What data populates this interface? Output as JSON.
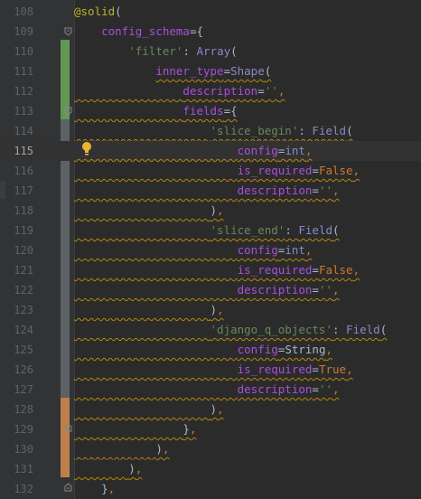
{
  "editor": {
    "current_line": "115",
    "colors": {
      "background": "#2b2b2b",
      "gutter": "#313335",
      "keyword_orange": "#cc7832",
      "string_green": "#6a8759",
      "builtin_blue": "#8888c6",
      "purple_kw": "#aa4fdb",
      "decorator_yellow": "#bbb529",
      "warning_wave": "#b8860b",
      "vcs_added": "#629755",
      "vcs_modified": "#5c6164",
      "vcs_changed": "#c07f4a"
    },
    "lines": [
      {
        "num": "108",
        "tokens": [
          {
            "t": "@solid",
            "c": "#bbb529"
          },
          {
            "t": "(",
            "c": "#a9b7c6"
          }
        ]
      },
      {
        "num": "109",
        "tokens": [
          {
            "t": "    "
          },
          {
            "t": "config_schema",
            "c": "#aa4fdb"
          },
          {
            "t": "={",
            "c": "#a9b7c6"
          }
        ]
      },
      {
        "num": "110",
        "tokens": [
          {
            "t": "        "
          },
          {
            "t": "'filter'",
            "c": "#6a8759"
          },
          {
            "t": ": ",
            "c": "#a9b7c6"
          },
          {
            "t": "Array",
            "c": "#8888c6"
          },
          {
            "t": "(",
            "c": "#a9b7c6"
          }
        ]
      },
      {
        "num": "111",
        "tokens": [
          {
            "t": "            "
          },
          {
            "t": "inner_type",
            "c": "#aa4fdb",
            "w": true
          },
          {
            "t": "=",
            "c": "#a9b7c6",
            "w": true
          },
          {
            "t": "Shape",
            "c": "#8888c6",
            "w": true
          },
          {
            "t": "(",
            "c": "#a9b7c6",
            "w": true
          }
        ]
      },
      {
        "num": "112",
        "tokens": [
          {
            "t": "                ",
            "w": true
          },
          {
            "t": "description",
            "c": "#aa4fdb",
            "w": true
          },
          {
            "t": "=",
            "c": "#a9b7c6",
            "w": true
          },
          {
            "t": "''",
            "c": "#6a8759",
            "w": true
          },
          {
            "t": ",",
            "c": "#cc7832",
            "w": true
          }
        ]
      },
      {
        "num": "113",
        "tokens": [
          {
            "t": "                ",
            "w": true
          },
          {
            "t": "fields",
            "c": "#aa4fdb",
            "w": true
          },
          {
            "t": "={",
            "c": "#a9b7c6",
            "w": true
          }
        ]
      },
      {
        "num": "114",
        "tokens": [
          {
            "t": "                    ",
            "w": true
          },
          {
            "t": "'slice_begin'",
            "c": "#6a8759",
            "w": true
          },
          {
            "t": ": ",
            "c": "#a9b7c6",
            "w": true
          },
          {
            "t": "Field",
            "c": "#8888c6",
            "w": true
          },
          {
            "t": "(",
            "c": "#a9b7c6",
            "w": true
          }
        ]
      },
      {
        "num": "115",
        "tokens": [
          {
            "t": "                        ",
            "w": true
          },
          {
            "t": "config",
            "c": "#aa4fdb",
            "w": true
          },
          {
            "t": "=",
            "c": "#a9b7c6",
            "w": true
          },
          {
            "t": "int",
            "c": "#8888c6",
            "w": true
          },
          {
            "t": ",",
            "c": "#cc7832",
            "w": true
          }
        ]
      },
      {
        "num": "116",
        "tokens": [
          {
            "t": "                        ",
            "w": true
          },
          {
            "t": "is_required",
            "c": "#aa4fdb",
            "w": true
          },
          {
            "t": "=",
            "c": "#a9b7c6",
            "w": true
          },
          {
            "t": "False",
            "c": "#cc7832",
            "w": true
          },
          {
            "t": ",",
            "c": "#cc7832",
            "w": true
          }
        ]
      },
      {
        "num": "117",
        "tokens": [
          {
            "t": "                        ",
            "w": true
          },
          {
            "t": "description",
            "c": "#aa4fdb",
            "w": true
          },
          {
            "t": "=",
            "c": "#a9b7c6",
            "w": true
          },
          {
            "t": "''",
            "c": "#6a8759",
            "w": true
          },
          {
            "t": ",",
            "c": "#cc7832",
            "w": true
          }
        ]
      },
      {
        "num": "118",
        "tokens": [
          {
            "t": "                    ",
            "w": true
          },
          {
            "t": ")",
            "c": "#a9b7c6",
            "w": true
          },
          {
            "t": ",",
            "c": "#cc7832",
            "w": true
          }
        ]
      },
      {
        "num": "119",
        "tokens": [
          {
            "t": "                    ",
            "w": true
          },
          {
            "t": "'slice_end'",
            "c": "#6a8759",
            "w": true
          },
          {
            "t": ": ",
            "c": "#a9b7c6",
            "w": true
          },
          {
            "t": "Field",
            "c": "#8888c6",
            "w": true
          },
          {
            "t": "(",
            "c": "#a9b7c6",
            "w": true
          }
        ]
      },
      {
        "num": "120",
        "tokens": [
          {
            "t": "                        ",
            "w": true
          },
          {
            "t": "config",
            "c": "#aa4fdb",
            "w": true
          },
          {
            "t": "=",
            "c": "#a9b7c6",
            "w": true
          },
          {
            "t": "int",
            "c": "#8888c6",
            "w": true
          },
          {
            "t": ",",
            "c": "#cc7832",
            "w": true
          }
        ]
      },
      {
        "num": "121",
        "tokens": [
          {
            "t": "                        ",
            "w": true
          },
          {
            "t": "is_required",
            "c": "#aa4fdb",
            "w": true
          },
          {
            "t": "=",
            "c": "#a9b7c6",
            "w": true
          },
          {
            "t": "False",
            "c": "#cc7832",
            "w": true
          },
          {
            "t": ",",
            "c": "#cc7832",
            "w": true
          }
        ]
      },
      {
        "num": "122",
        "tokens": [
          {
            "t": "                        ",
            "w": true
          },
          {
            "t": "description",
            "c": "#aa4fdb",
            "w": true
          },
          {
            "t": "=",
            "c": "#a9b7c6",
            "w": true
          },
          {
            "t": "''",
            "c": "#6a8759",
            "w": true
          },
          {
            "t": ",",
            "c": "#cc7832",
            "w": true
          }
        ]
      },
      {
        "num": "123",
        "tokens": [
          {
            "t": "                    ",
            "w": true
          },
          {
            "t": ")",
            "c": "#a9b7c6",
            "w": true
          },
          {
            "t": ",",
            "c": "#cc7832",
            "w": true
          }
        ]
      },
      {
        "num": "124",
        "tokens": [
          {
            "t": "                    ",
            "w": true
          },
          {
            "t": "'django_q_objects'",
            "c": "#6a8759",
            "w": true
          },
          {
            "t": ": ",
            "c": "#a9b7c6",
            "w": true
          },
          {
            "t": "Field",
            "c": "#8888c6",
            "w": true
          },
          {
            "t": "(",
            "c": "#a9b7c6",
            "w": true
          }
        ]
      },
      {
        "num": "125",
        "tokens": [
          {
            "t": "                        ",
            "w": true
          },
          {
            "t": "config",
            "c": "#aa4fdb",
            "w": true
          },
          {
            "t": "=",
            "c": "#a9b7c6",
            "w": true
          },
          {
            "t": "String",
            "c": "#a9b7c6",
            "w": true
          },
          {
            "t": ",",
            "c": "#cc7832",
            "w": true
          }
        ]
      },
      {
        "num": "126",
        "tokens": [
          {
            "t": "                        ",
            "w": true
          },
          {
            "t": "is_required",
            "c": "#aa4fdb",
            "w": true
          },
          {
            "t": "=",
            "c": "#a9b7c6",
            "w": true
          },
          {
            "t": "True",
            "c": "#cc7832",
            "w": true
          },
          {
            "t": ",",
            "c": "#cc7832",
            "w": true
          }
        ]
      },
      {
        "num": "127",
        "tokens": [
          {
            "t": "                        ",
            "w": true
          },
          {
            "t": "description",
            "c": "#aa4fdb",
            "w": true
          },
          {
            "t": "=",
            "c": "#a9b7c6",
            "w": true
          },
          {
            "t": "''",
            "c": "#6a8759",
            "w": true
          },
          {
            "t": ",",
            "c": "#cc7832",
            "w": true
          }
        ]
      },
      {
        "num": "128",
        "tokens": [
          {
            "t": "                    ",
            "w": true
          },
          {
            "t": ")",
            "c": "#a9b7c6",
            "w": true
          },
          {
            "t": ",",
            "c": "#cc7832",
            "w": true
          }
        ]
      },
      {
        "num": "129",
        "tokens": [
          {
            "t": "                ",
            "w": true
          },
          {
            "t": "}",
            "c": "#a9b7c6",
            "w": true
          },
          {
            "t": ",",
            "c": "#cc7832",
            "w": true
          }
        ]
      },
      {
        "num": "130",
        "tokens": [
          {
            "t": "            ",
            "w": true
          },
          {
            "t": ")",
            "c": "#a9b7c6",
            "w": true
          },
          {
            "t": ",",
            "c": "#cc7832",
            "w": true
          }
        ]
      },
      {
        "num": "131",
        "tokens": [
          {
            "t": "        ",
            "w": true
          },
          {
            "t": ")",
            "c": "#a9b7c6",
            "w": true
          },
          {
            "t": ",",
            "c": "#cc7832",
            "w": true
          }
        ]
      },
      {
        "num": "132",
        "tokens": [
          {
            "t": "    "
          },
          {
            "t": "}",
            "c": "#a9b7c6"
          },
          {
            "t": ",",
            "c": "#cc7832"
          }
        ]
      }
    ]
  }
}
